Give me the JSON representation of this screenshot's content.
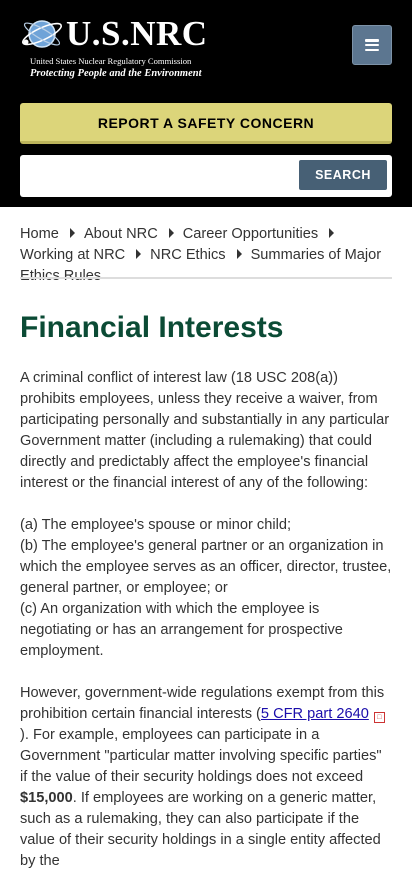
{
  "header": {
    "logo": {
      "title": "U.S.NRC",
      "subtitle": "United States Nuclear Regulatory Commission",
      "tagline": "Protecting People and the Environment"
    },
    "menu_icon": "hamburger-menu-icon",
    "report_button": "REPORT A SAFETY CONCERN",
    "search": {
      "placeholder": "",
      "button": "SEARCH"
    }
  },
  "breadcrumb": [
    "Home",
    "About NRC",
    "Career Opportunities",
    "Working at NRC",
    "NRC Ethics",
    "Summaries of Major Ethics Rules"
  ],
  "page": {
    "title": "Financial Interests",
    "para1": "A criminal conflict of interest law (18 USC 208(a)) prohibits employees, unless they receive a waiver, from participating personally and substantially in any particular Government matter (including a rulemaking) that could directly and predictably affect the employee's financial interest or the financial interest of any of the following:",
    "list": [
      "(a) The employee's spouse or minor child;",
      "(b) The employee's general partner or an organization in which the employee serves as an officer, director, trustee, general partner, or employee; or",
      "(c) An organization with which the employee is negotiating or has an arrangement for prospective employment."
    ],
    "para3_before_link": "However, government-wide regulations exempt from this prohibition certain financial interests (",
    "para3_link": "5 CFR part 2640",
    "para3_after_link": "). For example, employees can participate in a Government \"particular matter involving specific parties\" if the value of their security holdings does not exceed ",
    "para3_amount": "$15,000",
    "para3_end": ". If employees are working on a generic matter, such as a rulemaking, they can also participate if the value of their security holdings in a single entity affected by the"
  },
  "colors": {
    "header_bg": "#000000",
    "report_button": "#dcd57a",
    "search_button": "#476075",
    "menu_button": "#5c7690",
    "title": "#0b4b35"
  }
}
